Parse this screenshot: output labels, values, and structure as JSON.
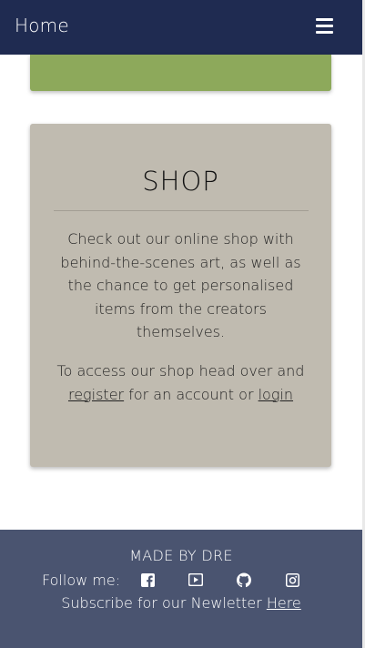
{
  "navbar": {
    "brand": "Home",
    "menu_icon": "hamburger-menu-icon",
    "background": "#1f2b51"
  },
  "cards": {
    "green_card_color": "#8da95b",
    "shop": {
      "title": "SHOP",
      "description": "Check out our online shop with behind-the-scenes art, as well as the chance to get personalised items from the creators themselves.",
      "access_prefix": "To access our shop head over and ",
      "register_link": "register",
      "access_middle": " for an account or ",
      "login_link": "login",
      "background": "#c0bbb0"
    }
  },
  "footer": {
    "credit": "MADE BY DRE",
    "follow_label": "Follow me:",
    "social_icons": [
      "facebook-icon",
      "youtube-icon",
      "github-icon",
      "instagram-icon"
    ],
    "subscribe_text": "Subscribe for our Newletter ",
    "subscribe_link": "Here",
    "background": "#4a5470"
  }
}
